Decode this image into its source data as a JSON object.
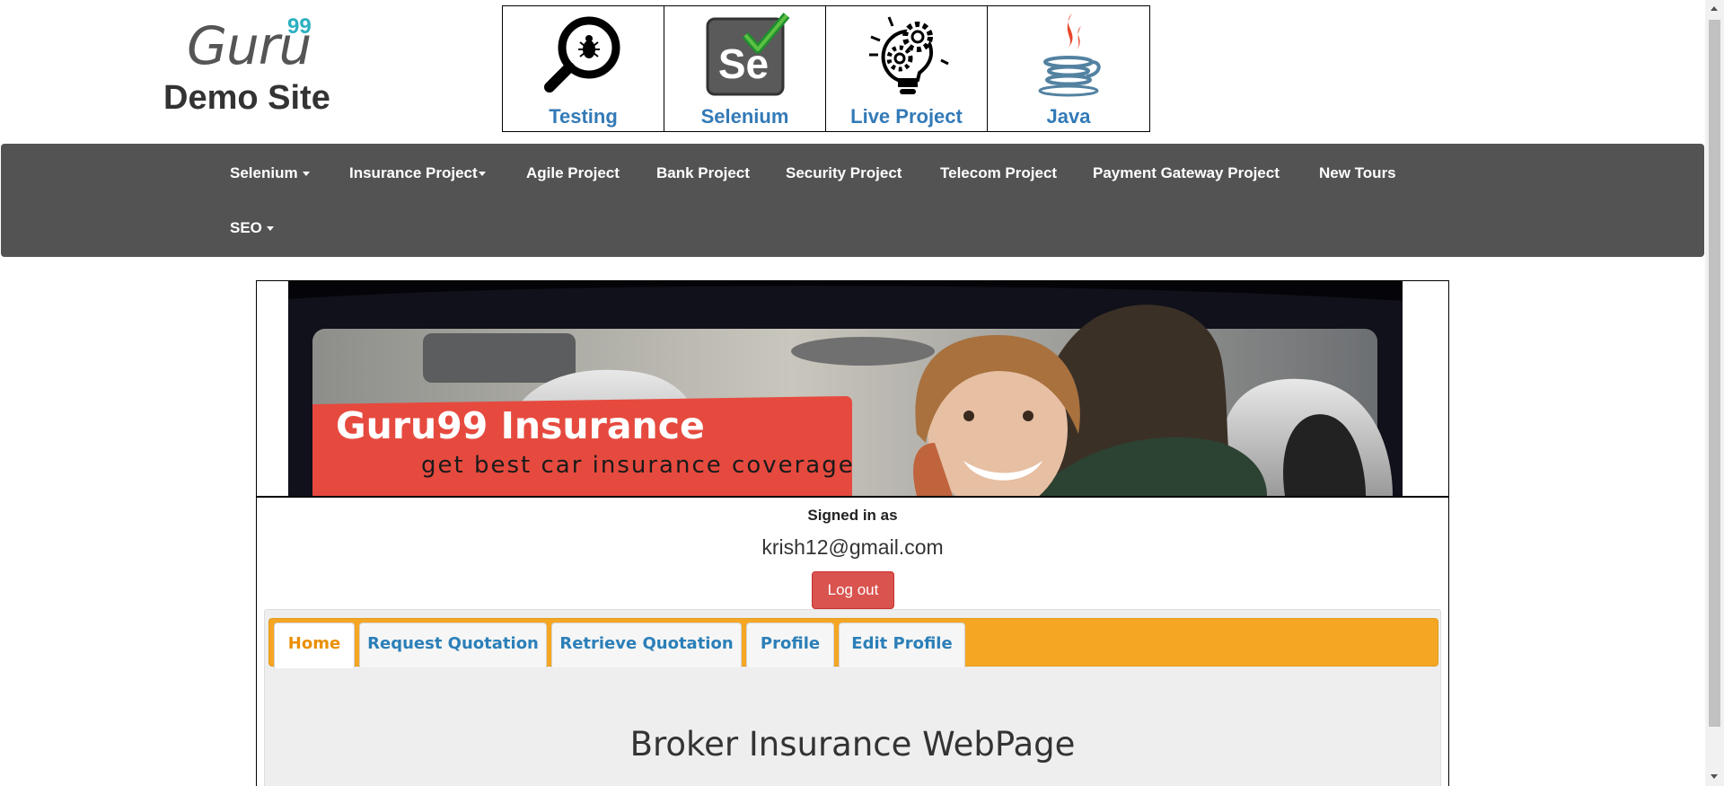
{
  "logo": {
    "brand": "Guru",
    "superscript": "99",
    "subtitle": "Demo Site"
  },
  "categories": [
    {
      "label": "Testing",
      "icon": "magnifier-bug-icon"
    },
    {
      "label": "Selenium",
      "icon": "selenium-se-check-icon"
    },
    {
      "label": "Live Project",
      "icon": "gear-lightbulb-icon"
    },
    {
      "label": "Java",
      "icon": "java-cup-icon"
    }
  ],
  "nav": {
    "items": [
      {
        "label": "Selenium",
        "dropdown": true
      },
      {
        "label": "Insurance Project",
        "dropdown": true
      },
      {
        "label": "Agile Project",
        "dropdown": false
      },
      {
        "label": "Bank Project",
        "dropdown": false
      },
      {
        "label": "Security Project",
        "dropdown": false
      },
      {
        "label": "Telecom Project",
        "dropdown": false
      },
      {
        "label": "Payment Gateway Project",
        "dropdown": false
      },
      {
        "label": "New Tours",
        "dropdown": false
      },
      {
        "label": "SEO",
        "dropdown": true
      }
    ]
  },
  "banner": {
    "title": "Guru99 Insurance",
    "tagline": "get best car insurance coverage"
  },
  "account": {
    "signed_in_label": "Signed in as",
    "email": "krish12@gmail.com",
    "logout_label": "Log out"
  },
  "tabs": [
    {
      "label": "Home",
      "active": true
    },
    {
      "label": "Request Quotation",
      "active": false
    },
    {
      "label": "Retrieve Quotation",
      "active": false
    },
    {
      "label": "Profile",
      "active": false
    },
    {
      "label": "Edit Profile",
      "active": false
    }
  ],
  "main": {
    "heading": "Broker Insurance WebPage"
  },
  "colors": {
    "navbar": "#535353",
    "tab_bar": "#f5a623",
    "active_tab_text": "#eb8f00",
    "tab_text": "#2b7fb8",
    "logout_button": "#d9534f",
    "banner_red": "#e64a3f",
    "link_blue": "#337ab7"
  }
}
